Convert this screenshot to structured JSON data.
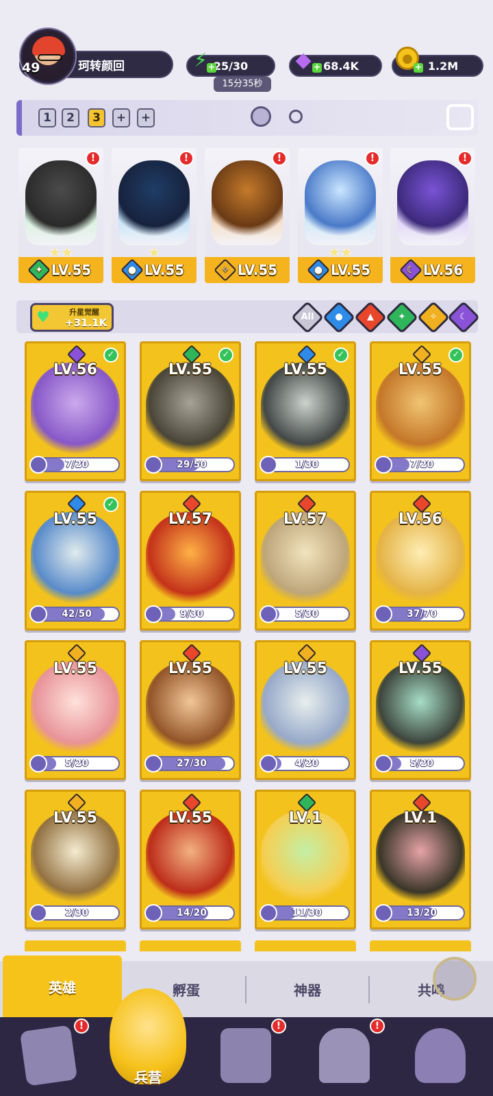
{
  "player": {
    "level": "49",
    "name": "珂转颜回"
  },
  "resources": {
    "energy": "25/30",
    "energy_timer": "15分35秒",
    "gems": "68.4K",
    "gold": "1.2M"
  },
  "teams": {
    "tabs": [
      "1",
      "2",
      "3",
      "+",
      "+"
    ],
    "selected": "3"
  },
  "team_heroes": [
    {
      "element": "wind",
      "level": "LV.55",
      "stars": 2,
      "alert": "!"
    },
    {
      "element": "water",
      "level": "LV.55",
      "stars": 1,
      "alert": "!"
    },
    {
      "element": "light",
      "level": "LV.55",
      "stars": 0,
      "alert": "!"
    },
    {
      "element": "water",
      "level": "LV.55",
      "stars": 2,
      "alert": "!"
    },
    {
      "element": "dark",
      "level": "LV.56",
      "stars": 0,
      "alert": "!"
    }
  ],
  "awaken": {
    "label": "升星觉醒",
    "value": "+31.1K"
  },
  "filters": {
    "all_label": "All",
    "elements": [
      "water",
      "fire",
      "wind",
      "light",
      "dark"
    ]
  },
  "heroes": [
    {
      "element": "dark",
      "level": "LV.56",
      "shards": "7/20",
      "progress": 0.35,
      "check": true
    },
    {
      "element": "wind",
      "level": "LV.55",
      "shards": "29/50",
      "progress": 0.58,
      "check": true
    },
    {
      "element": "water",
      "level": "LV.55",
      "shards": "1/30",
      "progress": 0.03,
      "check": true
    },
    {
      "element": "light",
      "level": "LV.55",
      "shards": "7/20",
      "progress": 0.35,
      "check": true
    },
    {
      "element": "water",
      "level": "LV.55",
      "shards": "42/50",
      "progress": 0.84,
      "check": true
    },
    {
      "element": "fire",
      "level": "LV.57",
      "shards": "9/30",
      "progress": 0.3,
      "check": false
    },
    {
      "element": "fire",
      "level": "LV.57",
      "shards": "5/30",
      "progress": 0.17,
      "check": false
    },
    {
      "element": "fire",
      "level": "LV.56",
      "shards": "37/70",
      "progress": 0.53,
      "check": false
    },
    {
      "element": "light",
      "level": "LV.55",
      "shards": "5/20",
      "progress": 0.25,
      "check": false
    },
    {
      "element": "fire",
      "level": "LV.55",
      "shards": "27/30",
      "progress": 0.9,
      "check": false
    },
    {
      "element": "light",
      "level": "LV.55",
      "shards": "4/20",
      "progress": 0.2,
      "check": false
    },
    {
      "element": "dark",
      "level": "LV.55",
      "shards": "5/20",
      "progress": 0.25,
      "check": false
    },
    {
      "element": "light",
      "level": "LV.55",
      "shards": "2/30",
      "progress": 0.07,
      "check": false
    },
    {
      "element": "fire",
      "level": "LV.55",
      "shards": "14/20",
      "progress": 0.7,
      "check": false
    },
    {
      "element": "wind",
      "level": "LV.1",
      "shards": "11/30",
      "progress": 0.37,
      "check": false
    },
    {
      "element": "fire",
      "level": "LV.1",
      "shards": "13/20",
      "progress": 0.65,
      "check": false
    }
  ],
  "tabs": {
    "hero": "英雄",
    "hatch": "孵蛋",
    "artifact": "神器",
    "resonance": "共鸣"
  },
  "nav": {
    "barracks": "兵营",
    "alert": "!"
  },
  "colors": {
    "water": "#2e8be8",
    "fire": "#e8472c",
    "wind": "#2fb65a",
    "light": "#f0b020",
    "dark": "#8a52d6",
    "accent": "#f5c31a"
  }
}
